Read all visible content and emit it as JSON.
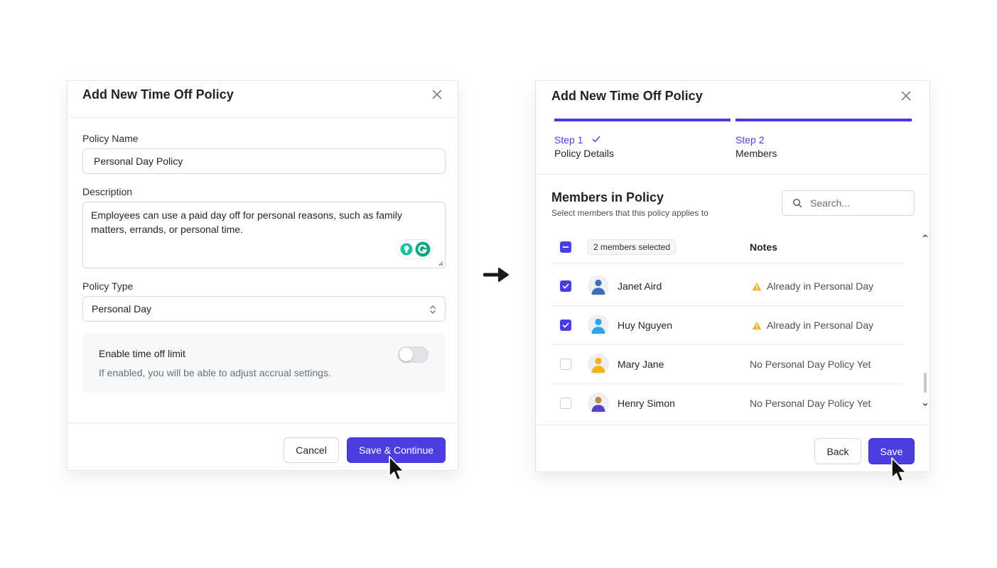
{
  "left_modal": {
    "title": "Add New Time Off Policy",
    "policy_name_label": "Policy Name",
    "policy_name_value": "Personal Day Policy",
    "description_label": "Description",
    "description_value": "Employees can use a paid day off for personal reasons, such as family matters, errands, or personal time.",
    "policy_type_label": "Policy Type",
    "policy_type_value": "Personal Day",
    "time_off_limit_title": "Enable time off limit",
    "time_off_limit_desc": "If enabled, you will be able to adjust accrual settings.",
    "time_off_limit_enabled": false,
    "cancel_label": "Cancel",
    "save_continue_label": "Save & Continue"
  },
  "right_modal": {
    "title": "Add New Time Off Policy",
    "steps": [
      {
        "label": "Step 1",
        "sub": "Policy Details",
        "completed": true
      },
      {
        "label": "Step 2",
        "sub": "Members",
        "completed": false
      }
    ],
    "section_title": "Members in Policy",
    "section_subtitle": "Select members that this policy applies to",
    "search_placeholder": "Search...",
    "selected_badge": "2 members selected",
    "notes_header": "Notes",
    "members": [
      {
        "name": "Janet Aird",
        "note": "Already in Personal Day",
        "warning": true,
        "checked": true,
        "avatar_color": "#3b6fb8"
      },
      {
        "name": "Huy Nguyen",
        "note": "Already in Personal Day",
        "warning": true,
        "checked": true,
        "avatar_color": "#2ba6e8"
      },
      {
        "name": "Mary Jane",
        "note": "No Personal Day Policy Yet",
        "warning": false,
        "checked": false,
        "avatar_color": "#f5b40b"
      },
      {
        "name": "Henry Simon",
        "note": "No Personal Day Policy Yet",
        "warning": false,
        "checked": false,
        "avatar_color": "#5b3fc6"
      }
    ],
    "back_label": "Back",
    "save_label": "Save"
  },
  "colors": {
    "accent": "#4a3ee0",
    "warning": "#f0b429"
  }
}
